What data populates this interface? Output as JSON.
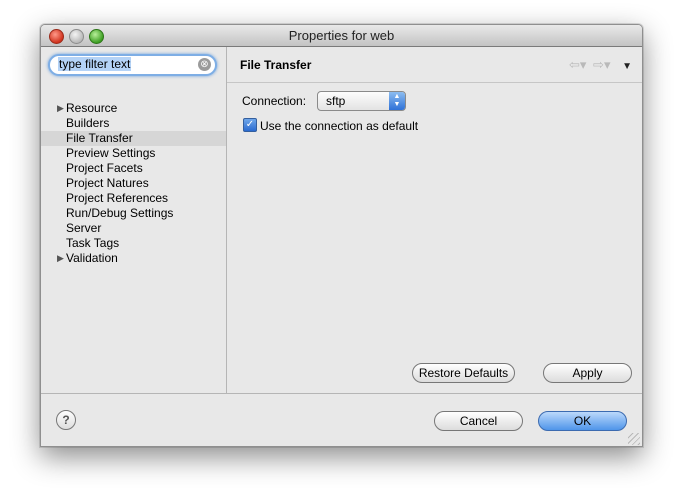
{
  "window": {
    "title": "Properties for web"
  },
  "filter": {
    "value": "type filter text",
    "clear_icon": "⊗"
  },
  "tree": {
    "items": [
      {
        "label": "Resource",
        "expandable": true
      },
      {
        "label": "Builders",
        "expandable": false
      },
      {
        "label": "File Transfer",
        "expandable": false,
        "selected": true
      },
      {
        "label": "Preview Settings",
        "expandable": false
      },
      {
        "label": "Project Facets",
        "expandable": false
      },
      {
        "label": "Project Natures",
        "expandable": false
      },
      {
        "label": "Project References",
        "expandable": false
      },
      {
        "label": "Run/Debug Settings",
        "expandable": false
      },
      {
        "label": "Server",
        "expandable": false
      },
      {
        "label": "Task Tags",
        "expandable": false
      },
      {
        "label": "Validation",
        "expandable": true
      }
    ]
  },
  "page": {
    "title": "File Transfer",
    "connection_label": "Connection:",
    "connection_value": "sftp",
    "default_checkbox_label": "Use the connection as default",
    "default_checked": true
  },
  "buttons": {
    "restore_defaults": "Restore Defaults",
    "apply": "Apply",
    "cancel": "Cancel",
    "ok": "OK",
    "help": "?"
  },
  "colors": {
    "accent": "#4f95ea",
    "selection": "#d6d6d6"
  }
}
